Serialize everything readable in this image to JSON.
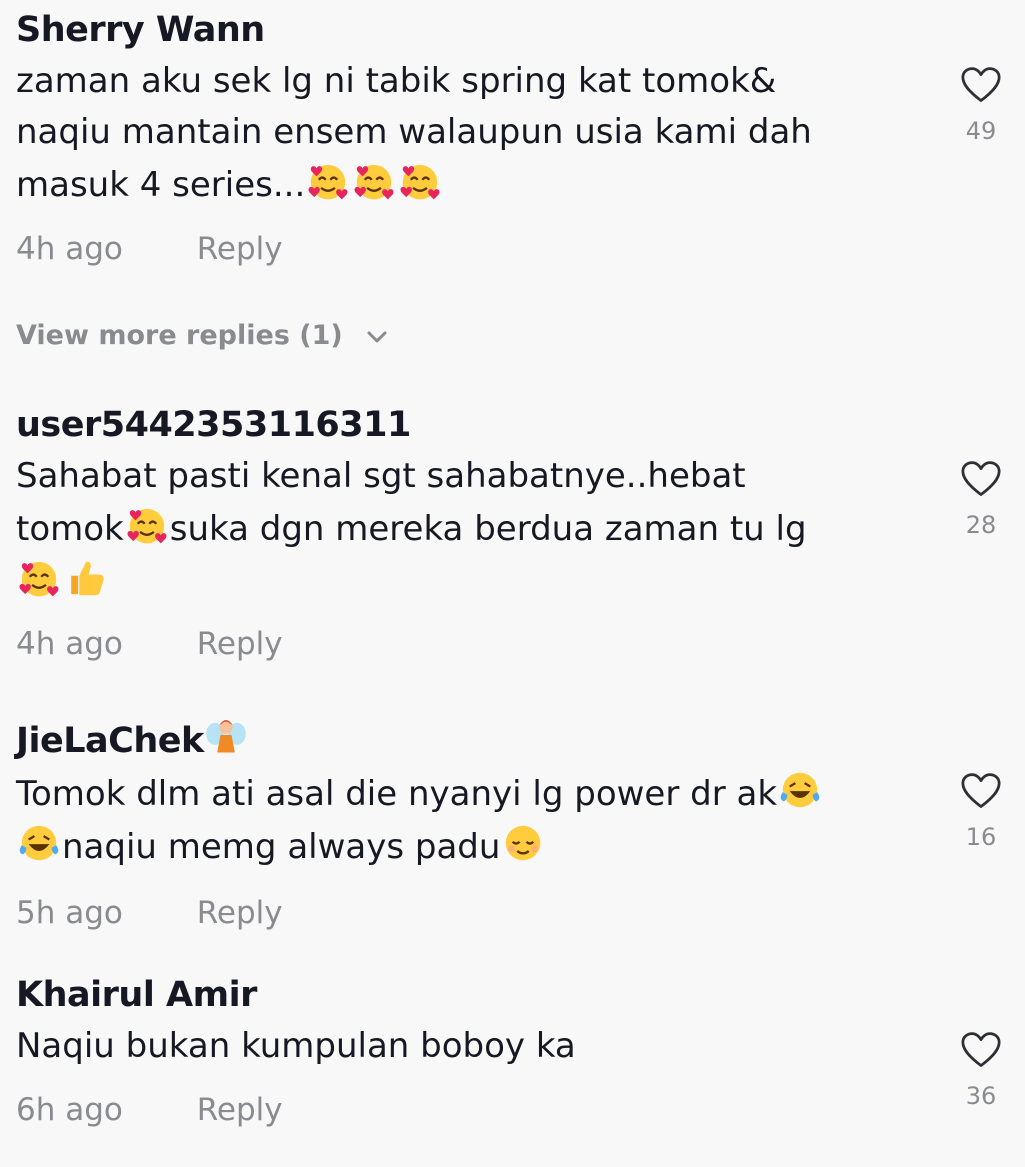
{
  "comments": [
    {
      "username": "Sherry Wann",
      "lines": [
        "zaman aku sek lg ni tabik spring kat tomok&",
        "naqiu mantain ensem walaupun usia kami dah",
        "masuk 4 series..."
      ],
      "time": "4h ago",
      "reply_label": "Reply",
      "likes": "49"
    },
    {
      "username": "user5442353116311",
      "lines": [
        "Sahabat pasti kenal sgt sahabatnye..hebat",
        "tomok",
        "suka dgn mereka berdua zaman tu lg"
      ],
      "time": "4h ago",
      "reply_label": "Reply",
      "likes": "28"
    },
    {
      "username": "JieLaChek",
      "lines": [
        "Tomok dlm ati asal die nyanyi lg power dr ak",
        "naqiu memg always padu"
      ],
      "time": "5h ago",
      "reply_label": "Reply",
      "likes": "16"
    },
    {
      "username": "Khairul Amir",
      "lines": [
        "Naqiu bukan kumpulan boboy ka"
      ],
      "time": "6h ago",
      "reply_label": "Reply",
      "likes": "36"
    }
  ],
  "view_more_replies": "View more replies (1)",
  "icons": {
    "like": "heart-outline-icon",
    "expand": "chevron-down-icon",
    "emoji_love": "smiling-face-with-hearts",
    "emoji_laugh": "face-with-tears-of-joy",
    "emoji_thumbs": "thumbs-up",
    "emoji_fairy": "fairy",
    "emoji_relieved": "relieved-face"
  },
  "colors": {
    "background": "#f8f8f8",
    "text": "#161823",
    "secondary": "#8a8b91"
  }
}
